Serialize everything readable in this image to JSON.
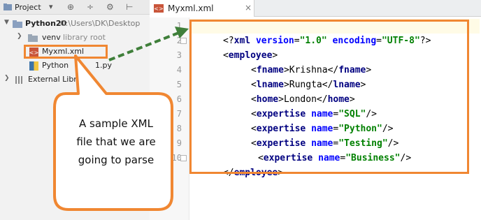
{
  "project_panel": {
    "header": {
      "title": "Project"
    },
    "tree": {
      "root": {
        "name": "Python20",
        "path": "C:\\Users\\DK\\Desktop"
      },
      "venv": {
        "name": "venv",
        "note": "library root"
      },
      "xml_file": {
        "name": "Myxml.xml"
      },
      "py_file": {
        "name": "Python",
        "suffix": "1.py"
      },
      "external": {
        "name": "External Libra"
      }
    }
  },
  "editor": {
    "tab": {
      "label": "Myxml.xml"
    },
    "line_numbers": [
      "1",
      "2",
      "3",
      "4",
      "5",
      "6",
      "7",
      "8",
      "9",
      "10"
    ],
    "code": {
      "l1": {
        "open": "<?",
        "name": "xml",
        "a1": "version",
        "eq1": "=",
        "v1": "\"1.0\"",
        "a2": "encoding",
        "eq2": "=",
        "v2": "\"UTF-8\"",
        "close": "?>"
      },
      "l2": {
        "lt": "<",
        "tag": "employee",
        "gt": ">"
      },
      "l3": {
        "lt": "<",
        "tag": "fname",
        "gt": ">",
        "text": "Krishna",
        "lt2": "</",
        "tag2": "fname",
        "gt2": ">"
      },
      "l4": {
        "lt": "<",
        "tag": "lname",
        "gt": ">",
        "text": "Rungta",
        "lt2": "</",
        "tag2": "lname",
        "gt2": ">"
      },
      "l5": {
        "lt": "<",
        "tag": "home",
        "gt": ">",
        "text": "London",
        "lt2": "</",
        "tag2": "home",
        "gt2": ">"
      },
      "l6": {
        "lt": "<",
        "tag": "expertise",
        "attr": "name",
        "eq": "=",
        "val": "\"SQL\"",
        "end": "/>"
      },
      "l7": {
        "lt": "<",
        "tag": "expertise",
        "attr": "name",
        "eq": "=",
        "val": "\"Python\"",
        "end": "/>"
      },
      "l8": {
        "lt": "<",
        "tag": "expertise",
        "attr": "name",
        "eq": "=",
        "val": "\"Testing\"",
        "end": "/>"
      },
      "l9": {
        "lt": "<",
        "tag": "expertise",
        "attr": "name",
        "eq": "=",
        "val": "\"Business\"",
        "end": "/>"
      },
      "l10": {
        "lt": "</",
        "tag": "employee",
        "gt": ">"
      }
    }
  },
  "annotation": {
    "callout_lines": [
      "A sample XML",
      "file that we are",
      "going to parse"
    ],
    "accent": "#f08732",
    "arrow_color": "#3f7f3a"
  },
  "colors": {
    "tag": "#000080",
    "attribute": "#0000ff",
    "value": "#008000",
    "line_number": "#999999",
    "selection": "#dbe2ee"
  }
}
